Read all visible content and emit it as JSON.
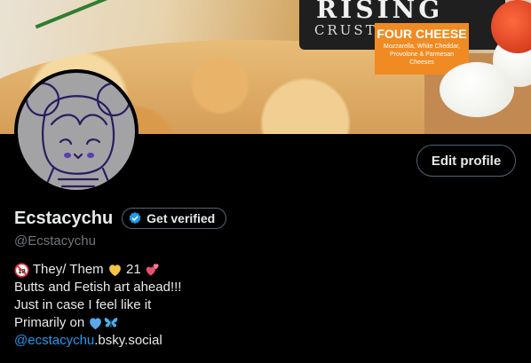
{
  "profile": {
    "display_name": "Ecstacychu",
    "handle": "@Ecstacychu",
    "edit_profile_label": "Edit profile",
    "get_verified_label": "Get verified"
  },
  "banner": {
    "brand_line1": "RISING",
    "brand_line2": "CRUST",
    "flavor_title": "FOUR CHEESE",
    "flavor_desc": "Mozzarella, White Cheddar, Provolone & Parmesan Cheeses"
  },
  "bio": {
    "line1_a": " They/ Them ",
    "line1_b": " 21 ",
    "line2": "Butts and Fetish art ahead!!!",
    "line3": "Just in case I feel like it",
    "line4": "Primarily on ",
    "link_handle": "@ecstacychu",
    "link_domain": ".bsky.social"
  },
  "icons": {
    "age_badge": "no-under-18-icon",
    "heart_yellow": "yellow-heart-icon",
    "heart_pink": "two-hearts-icon",
    "heart_blue": "blue-heart-icon",
    "butterfly": "butterfly-icon",
    "verified": "verified-badge-icon"
  },
  "colors": {
    "background": "#000000",
    "accent_blue": "#1d9bf0",
    "text_primary": "#e7e9ea",
    "text_secondary": "#71767b",
    "border": "#536471"
  }
}
